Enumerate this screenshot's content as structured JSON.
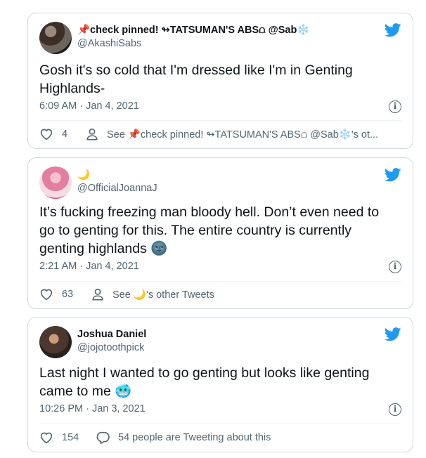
{
  "colors": {
    "twitter_blue": "#1d9bf0",
    "text": "#0f1419",
    "secondary": "#536471",
    "border": "#cfd9de"
  },
  "tweets": [
    {
      "display_name": "📌check pinned! ↬TATSUMAN'S ABS⩍ @Sab❄️",
      "handle": "@AkashiSabs",
      "text_line1": "Gosh it's so cold that I'm dressed like I'm in Genting",
      "text_line2": "Highlands-",
      "timestamp": "6:09 AM · Jan 4, 2021",
      "likes": "4",
      "secondary_action": "See 📌check pinned! ↬TATSUMAN'S ABS⩍ @Sab❄️'s ot..."
    },
    {
      "display_name": "🌙",
      "handle": "@OfficialJoannaJ",
      "text_line1": "It’s fucking freezing man bloody hell. Don’t even need to",
      "text_line2": "go to genting for this. The entire country is currently",
      "text_line3": "genting highlands 🌚",
      "timestamp": "2:21 AM · Jan 4, 2021",
      "likes": "63",
      "secondary_action": "See 🌙’s other Tweets"
    },
    {
      "display_name": "Joshua Daniel",
      "handle": "@jojotoothpick",
      "text_line1": "Last night I wanted to go genting but looks like genting",
      "text_line2": "came to me 🥶",
      "timestamp": "10:26 PM · Jan 3, 2021",
      "likes": "154",
      "secondary_action": "54 people are Tweeting about this"
    }
  ],
  "icons": [
    "avatar",
    "twitter-bird-icon",
    "info-icon",
    "heart-icon",
    "person-icon",
    "reply-icon"
  ]
}
